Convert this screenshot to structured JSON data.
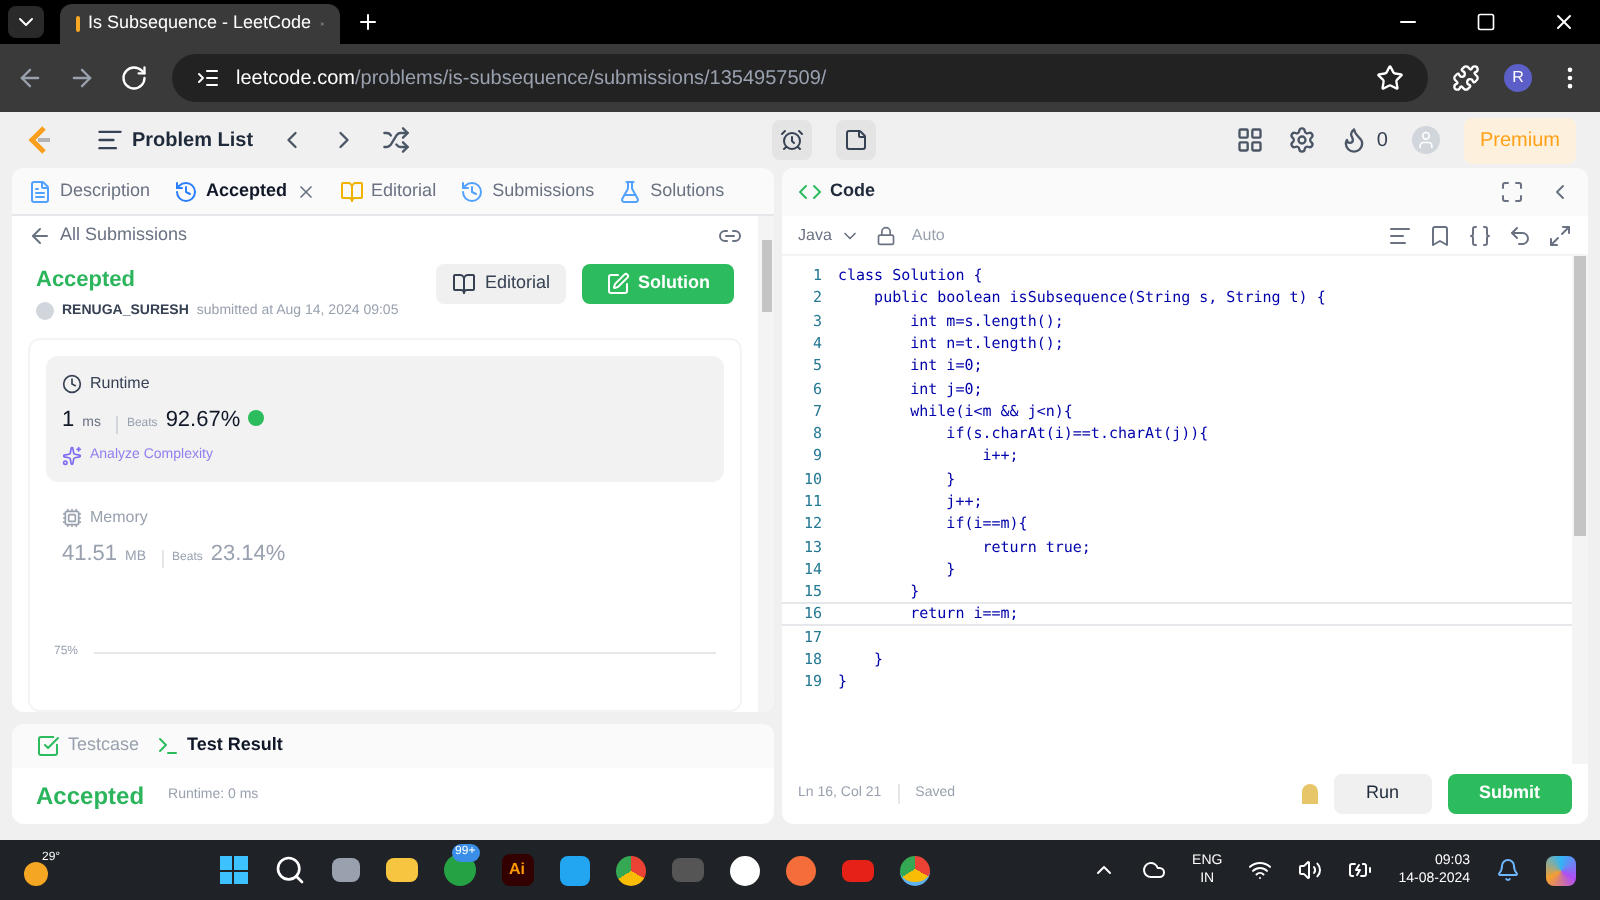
{
  "browser": {
    "tab_title": "Is Subsequence - LeetCode",
    "url_host": "leetcode.com",
    "url_path": "/problems/is-subsequence/submissions/1354957509/",
    "profile_initial": "R"
  },
  "header": {
    "problem_list": "Problem List",
    "streak": "0",
    "premium": "Premium"
  },
  "left_tabs": [
    {
      "label": "Description",
      "selected": false,
      "closable": false
    },
    {
      "label": "Accepted",
      "selected": true,
      "closable": true
    },
    {
      "label": "Editorial",
      "selected": false,
      "closable": false
    },
    {
      "label": "Submissions",
      "selected": false,
      "closable": false
    },
    {
      "label": "Solutions",
      "selected": false,
      "closable": false
    }
  ],
  "submission": {
    "back": "All Submissions",
    "status": "Accepted",
    "user": "RENUGA_SURESH",
    "submitted": "submitted at Aug 14, 2024 09:05",
    "editorial_button": "Editorial",
    "solution_button": "Solution",
    "runtime": {
      "title": "Runtime",
      "value": "1",
      "unit": "ms",
      "beats_label": "Beats",
      "beats": "92.67%",
      "analyze": "Analyze Complexity"
    },
    "memory": {
      "title": "Memory",
      "value": "41.51",
      "unit": "MB",
      "beats_label": "Beats",
      "beats": "23.14%"
    },
    "chart_tick": "75%"
  },
  "bottom_tabs": [
    {
      "label": "Testcase",
      "selected": false
    },
    {
      "label": "Test Result",
      "selected": true
    }
  ],
  "test_result": {
    "status": "Accepted",
    "runtime": "Runtime: 0 ms"
  },
  "code_panel": {
    "title": "Code",
    "language": "Java",
    "mode": "Auto",
    "lines": [
      {
        "number": "1",
        "text": "class Solution {",
        "current": false
      },
      {
        "number": "2",
        "text": "    public boolean isSubsequence(String s, String t) {",
        "current": false
      },
      {
        "number": "3",
        "text": "        int m=s.length();",
        "current": false
      },
      {
        "number": "4",
        "text": "        int n=t.length();",
        "current": false
      },
      {
        "number": "5",
        "text": "        int i=0;",
        "current": false
      },
      {
        "number": "6",
        "text": "        int j=0;",
        "current": false
      },
      {
        "number": "7",
        "text": "        while(i<m && j<n){",
        "current": false
      },
      {
        "number": "8",
        "text": "            if(s.charAt(i)==t.charAt(j)){",
        "current": false
      },
      {
        "number": "9",
        "text": "                i++;",
        "current": false
      },
      {
        "number": "10",
        "text": "            }",
        "current": false
      },
      {
        "number": "11",
        "text": "            j++;",
        "current": false
      },
      {
        "number": "12",
        "text": "            if(i==m){",
        "current": false
      },
      {
        "number": "13",
        "text": "                return true;",
        "current": false
      },
      {
        "number": "14",
        "text": "            }",
        "current": false
      },
      {
        "number": "15",
        "text": "        }",
        "current": false
      },
      {
        "number": "16",
        "text": "        return i==m;",
        "current": true
      },
      {
        "number": "17",
        "current": false
      },
      {
        "number": "18",
        "text": "    }",
        "current": false
      },
      {
        "number": "19",
        "text": "}",
        "current": false
      }
    ],
    "cursor": "Ln 16, Col 21",
    "saved": "Saved",
    "run": "Run",
    "submit": "Submit"
  },
  "taskbar": {
    "temperature": "29°",
    "badge": "99+",
    "ai_label": "Ai",
    "lang_top": "ENG",
    "lang_bottom": "IN",
    "time": "09:03",
    "date": "14-08-2024"
  }
}
